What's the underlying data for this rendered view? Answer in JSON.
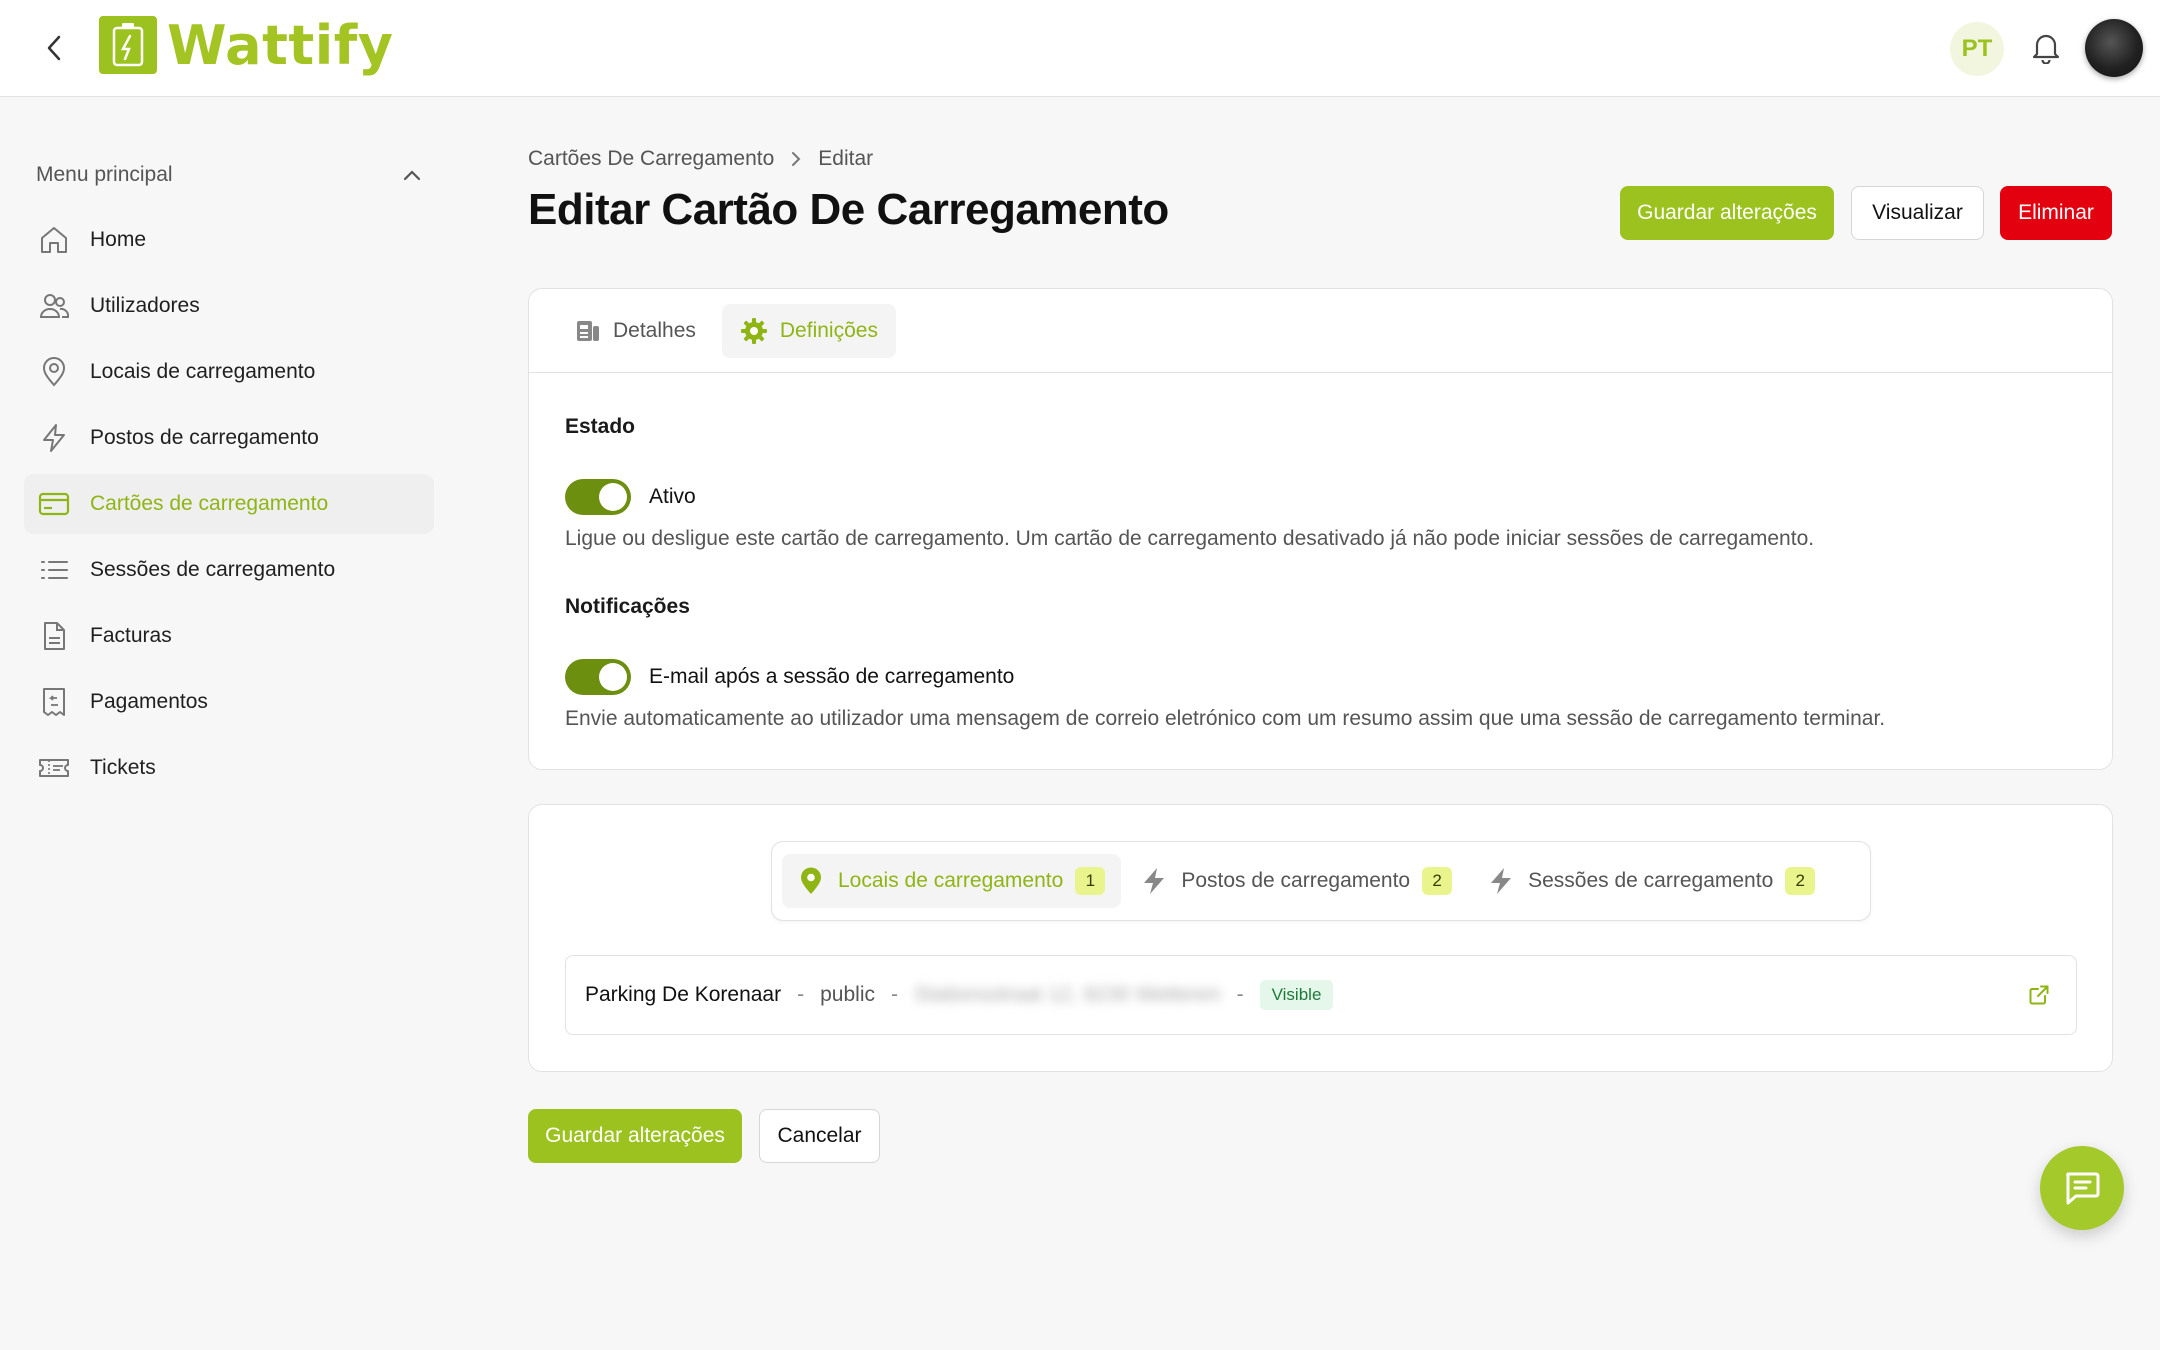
{
  "app": {
    "name": "Wattify",
    "language_badge": "PT"
  },
  "sidebar": {
    "header": "Menu principal",
    "items": [
      {
        "label": "Home",
        "icon": "home-icon"
      },
      {
        "label": "Utilizadores",
        "icon": "users-icon"
      },
      {
        "label": "Locais de carregamento",
        "icon": "location-pin-icon"
      },
      {
        "label": "Postos de carregamento",
        "icon": "lightning-icon"
      },
      {
        "label": "Cartões de carregamento",
        "icon": "credit-card-icon",
        "active": true
      },
      {
        "label": "Sessões de carregamento",
        "icon": "list-icon"
      },
      {
        "label": "Facturas",
        "icon": "document-icon"
      },
      {
        "label": "Pagamentos",
        "icon": "receipt-icon"
      },
      {
        "label": "Tickets",
        "icon": "ticket-icon"
      }
    ]
  },
  "breadcrumb": {
    "parent": "Cartões De Carregamento",
    "current": "Editar"
  },
  "page": {
    "title": "Editar Cartão De Carregamento"
  },
  "header_actions": {
    "save": "Guardar alterações",
    "preview": "Visualizar",
    "delete": "Eliminar"
  },
  "tabs": {
    "details": "Detalhes",
    "settings": "Definições",
    "active": "settings"
  },
  "settings": {
    "status": {
      "title": "Estado",
      "toggle_label": "Ativo",
      "enabled": true,
      "help": "Ligue ou desligue este cartão de carregamento. Um cartão de carregamento desativado já não pode iniciar sessões de carregamento."
    },
    "notifications": {
      "title": "Notificações",
      "toggle_label": "E-mail após a sessão de carregamento",
      "enabled": true,
      "help": "Envie automaticamente ao utilizador uma mensagem de correio eletrónico com um resumo assim que uma sessão de carregamento terminar."
    }
  },
  "related": {
    "tabs": [
      {
        "label": "Locais de carregamento",
        "count": "1",
        "active": true
      },
      {
        "label": "Postos de carregamento",
        "count": "2"
      },
      {
        "label": "Sessões de carregamento",
        "count": "2"
      }
    ],
    "rows": [
      {
        "name": "Parking De Korenaar",
        "access": "public",
        "address": "Stationsstraat 12, 9230 Wetteren",
        "badge": "Visible"
      }
    ]
  },
  "footer_actions": {
    "save": "Guardar alterações",
    "cancel": "Cancelar"
  },
  "colors": {
    "brand": "#9bc21e",
    "danger": "#e3000f",
    "toggle_on": "#6d8f10",
    "count_badge": "#e9f48c"
  }
}
